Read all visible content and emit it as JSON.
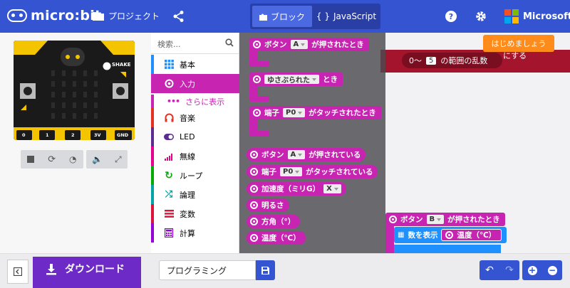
{
  "header": {
    "logo": "micro:bit",
    "projects_label": "プロジェクト",
    "tab_blocks": "ブロック",
    "tab_js": "JavaScript",
    "microsoft": "Microsoft"
  },
  "simulator": {
    "shake_label": "SHAKE",
    "pins": [
      "0",
      "1",
      "2",
      "3V",
      "GND"
    ]
  },
  "toolbox": {
    "search_placeholder": "検索...",
    "categories": [
      {
        "label": "基本",
        "color": "#1E90FF"
      },
      {
        "label": "入力",
        "color": "#C724B1"
      },
      {
        "label": "音楽",
        "color": "#E63022"
      },
      {
        "label": "LED",
        "color": "#5C2D91"
      },
      {
        "label": "無線",
        "color": "#E3008C"
      },
      {
        "label": "ループ",
        "color": "#00AA00"
      },
      {
        "label": "論理",
        "color": "#00A4A6"
      },
      {
        "label": "変数",
        "color": "#DC143C"
      },
      {
        "label": "計算",
        "color": "#9400D3"
      }
    ],
    "more_label": "さらに表示"
  },
  "flyout": {
    "b1_pre": "ボタン",
    "b1_dd": "A",
    "b1_post": "が押されたとき",
    "b2_pre": "ゆさぶられた",
    "b2_post": "とき",
    "b3_pre": "端子",
    "b3_dd": "P0",
    "b3_post": "がタッチされたとき",
    "b4_pre": "ボタン",
    "b4_dd": "A",
    "b4_post": "が押されている",
    "b5_pre": "端子",
    "b5_dd": "P0",
    "b5_post": "がタッチされている",
    "b6_pre": "加速度（ミリG）",
    "b6_dd": "X",
    "b7": "明るさ",
    "b8": "方角（°）",
    "b9": "温度（℃）"
  },
  "workspace": {
    "start_button": "はじめましょう",
    "red_text": "にする",
    "rand_from": "0〜",
    "rand_to": "5",
    "rand_suffix": "の範囲の乱数",
    "event_pre": "ボタン",
    "event_dd": "B",
    "event_post": "が押されたとき",
    "show_number": "数を表示",
    "temp_block": "温度（℃）"
  },
  "footer": {
    "download": "ダウンロード",
    "project_name": "プログラミング"
  }
}
